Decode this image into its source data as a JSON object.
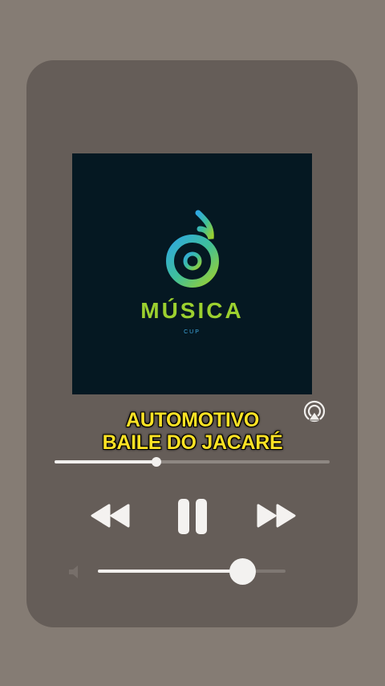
{
  "player": {
    "cover": {
      "brand": "MÚSICA",
      "brand_sub": "CUP"
    },
    "track": {
      "line1": "AUTOMOTIVO",
      "line2": "BAILE DO JACARÉ"
    },
    "progress": 0.37,
    "volume": 0.77,
    "controls": [
      "rewind-icon",
      "pause-icon",
      "fast-forward-icon"
    ],
    "output_icon": "airplay-icon",
    "colors": {
      "background": "#857c74",
      "card": "#655d58",
      "cover_bg": "#051822",
      "brand_green": "#9cd02f",
      "brand_blue": "#3fa7dd",
      "title_yellow": "#fbe225"
    }
  }
}
